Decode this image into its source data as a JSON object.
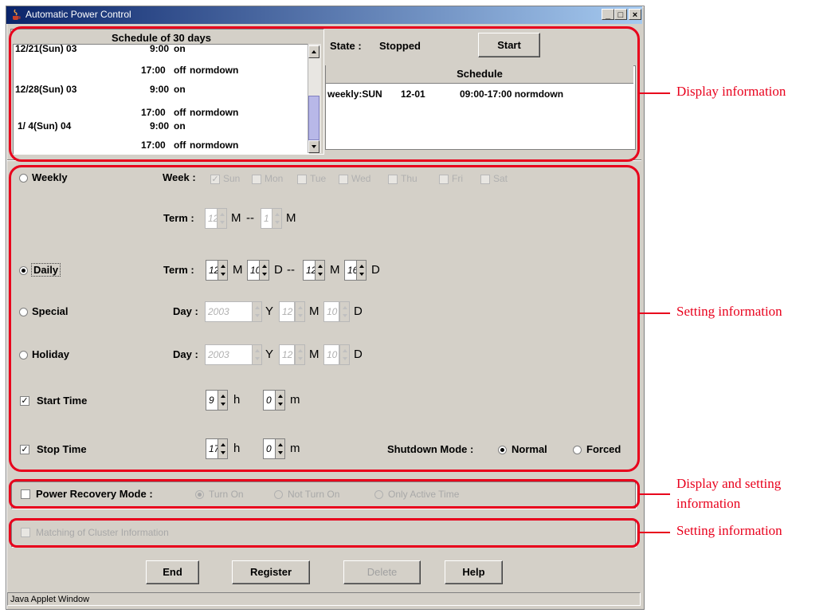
{
  "window": {
    "title": "Automatic Power Control",
    "statusbar": "Java Applet Window",
    "min_label": "_",
    "max_label": "□",
    "close_label": "×"
  },
  "schedule30": {
    "header": "Schedule of 30 days",
    "rows": [
      {
        "date": "12/21(Sun) 03",
        "time": "9:00",
        "act": "on",
        "mode": ""
      },
      {
        "date": "",
        "time": "17:00",
        "act": "off",
        "mode": "normdown"
      },
      {
        "date": "12/28(Sun) 03",
        "time": "9:00",
        "act": "on",
        "mode": ""
      },
      {
        "date": "",
        "time": "17:00",
        "act": "off",
        "mode": "normdown"
      },
      {
        "date": "1/ 4(Sun) 04",
        "time": "9:00",
        "act": "on",
        "mode": ""
      },
      {
        "date": "",
        "time": "17:00",
        "act": "off",
        "mode": "normdown"
      }
    ]
  },
  "state": {
    "label": "State :",
    "value": "Stopped",
    "start_button": "Start"
  },
  "schedule": {
    "header": "Schedule",
    "row": {
      "type": "weekly:SUN",
      "date": "12-01",
      "time": "09:00-17:00 normdown"
    }
  },
  "settings": {
    "weekly": {
      "label": "Weekly",
      "week_label": "Week :",
      "days": [
        {
          "label": "Sun",
          "checked": true
        },
        {
          "label": "Mon",
          "checked": false
        },
        {
          "label": "Tue",
          "checked": false
        },
        {
          "label": "Wed",
          "checked": false
        },
        {
          "label": "Thu",
          "checked": false
        },
        {
          "label": "Fri",
          "checked": false
        },
        {
          "label": "Sat",
          "checked": false
        }
      ],
      "term_label": "Term :",
      "from_m": "12",
      "to_m": "1",
      "m_unit": "M",
      "dash": "--"
    },
    "daily": {
      "label": "Daily",
      "term_label": "Term :",
      "from_m": "12",
      "from_d": "10",
      "to_m": "12",
      "to_d": "16",
      "m_unit": "M",
      "d_unit": "D",
      "dash": "--"
    },
    "special": {
      "label": "Special",
      "day_label": "Day :",
      "y": "2003",
      "m": "12",
      "d": "10",
      "y_unit": "Y",
      "m_unit": "M",
      "d_unit": "D"
    },
    "holiday": {
      "label": "Holiday",
      "day_label": "Day :",
      "y": "2003",
      "m": "12",
      "d": "10",
      "y_unit": "Y",
      "m_unit": "M",
      "d_unit": "D"
    },
    "start_time": {
      "label": "Start Time",
      "checked": true,
      "h": "9",
      "m": "0",
      "h_unit": "h",
      "m_unit": "m"
    },
    "stop_time": {
      "label": "Stop Time",
      "checked": true,
      "h": "17",
      "m": "0",
      "h_unit": "h",
      "m_unit": "m"
    },
    "shutdown": {
      "label": "Shutdown Mode :",
      "normal": "Normal",
      "forced": "Forced",
      "selected": "Normal"
    },
    "selected_mode": "Daily"
  },
  "recovery": {
    "label": "Power Recovery Mode :",
    "opt1": "Turn On",
    "opt2": "Not Turn On",
    "opt3": "Only Active Time"
  },
  "cluster": {
    "label": "Matching of Cluster Information"
  },
  "buttons": {
    "end": "End",
    "register": "Register",
    "delete": "Delete",
    "help": "Help"
  },
  "annotations": {
    "display": "Display information",
    "setting": "Setting information",
    "display_setting_1": "Display and setting",
    "display_setting_2": "information",
    "setting2": "Setting information",
    "color": "#e8001c"
  }
}
